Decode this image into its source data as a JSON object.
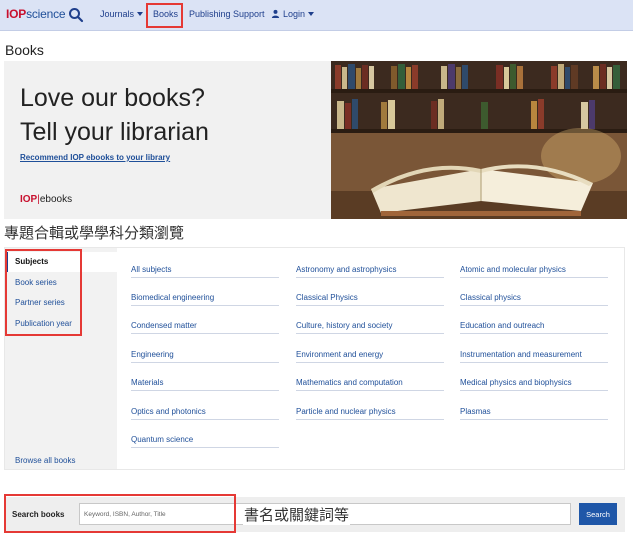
{
  "nav": {
    "logo_iop": "IOP",
    "logo_science": "science",
    "search_icon": "search-icon",
    "items": [
      {
        "label": "Journals",
        "has_caret": true
      },
      {
        "label": "Books",
        "has_caret": false
      },
      {
        "label": "Publishing Support",
        "has_caret": false
      },
      {
        "label": "Login",
        "has_caret": true
      }
    ],
    "user_icon": "user-icon"
  },
  "page": {
    "title": "Books"
  },
  "hero": {
    "line1": "Love our books?",
    "line2": "Tell your librarian",
    "link": "Recommend IOP ebooks to your library",
    "brand_iop": "IOP",
    "brand_ebooks": "ebooks"
  },
  "annotations": {
    "browse_note": "專題合輯或學學科分類瀏覽",
    "search_note": "書名或關鍵詞等"
  },
  "browse": {
    "tabs": [
      "Subjects",
      "Book series",
      "Partner series",
      "Publication year"
    ],
    "active_tab": "Subjects",
    "browse_all": "Browse all books",
    "subjects": [
      [
        "All subjects",
        "Astronomy and astrophysics",
        "Atomic and molecular physics"
      ],
      [
        "Biomedical engineering",
        "Classical Physics",
        "Classical physics"
      ],
      [
        "Condensed matter",
        "Culture, history and society",
        "Education and outreach"
      ],
      [
        "Engineering",
        "Environment and energy",
        "Instrumentation and measurement"
      ],
      [
        "Materials",
        "Mathematics and computation",
        "Medical physics and biophysics"
      ],
      [
        "Optics and photonics",
        "Particle and nuclear physics",
        "Plasmas"
      ],
      [
        "Quantum science"
      ]
    ]
  },
  "search": {
    "label": "Search books",
    "placeholder": "Keyword, ISBN, Author, Title",
    "button": "Search"
  },
  "colors": {
    "nav_bg": "#dbe3f5",
    "link": "#1f4f99",
    "highlight": "#e53935",
    "button": "#1f57a8",
    "iop_red": "#c8102e"
  }
}
